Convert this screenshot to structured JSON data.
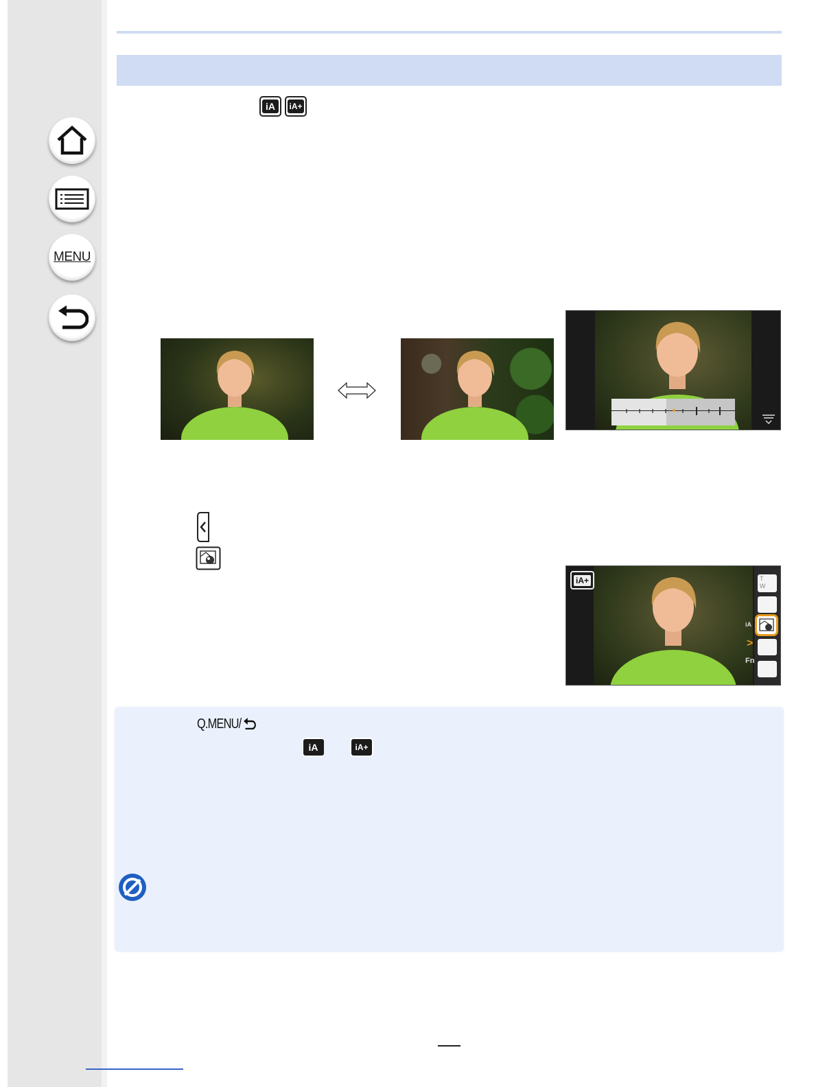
{
  "sidebar": {
    "home_icon": "home-icon",
    "contents_icon": "list-icon",
    "menu_label": "MENU",
    "back_icon": "return-icon"
  },
  "modes": {
    "header_icons": [
      "iA",
      "iA+"
    ],
    "note_icons": [
      "iA",
      "iA+"
    ]
  },
  "note": {
    "qmenu_label": "Q.MENU/"
  },
  "touch_panel": {
    "tab_icon": "chevron-left-icon",
    "defocus_icon": "defocus-control-icon",
    "right_column_labels": [
      "T",
      "W",
      "iA",
      "Fn"
    ]
  },
  "colors": {
    "sidebar": "#e6e6e6",
    "title_band": "#d0dcf3",
    "note_box": "#eaf1fc",
    "prohibit_icon": "#1f5fc2",
    "highlight": "#e89a1b"
  }
}
